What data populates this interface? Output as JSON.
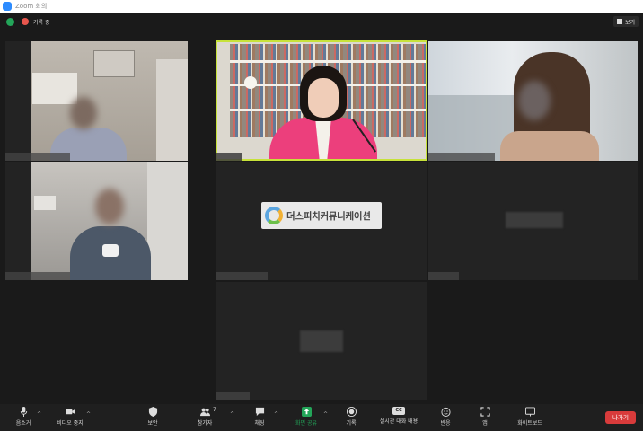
{
  "window": {
    "title": "Zoom 회의"
  },
  "topbar": {
    "recording_label": "기록 중",
    "view_label": "보기"
  },
  "logo": {
    "text": "더스피치커뮤니케이션"
  },
  "toolbar": {
    "mute": "음소거",
    "video": "비디오 중지",
    "security": "보안",
    "participants": "참가자",
    "participants_count": "7",
    "chat": "채팅",
    "share": "화면 공유",
    "record": "기록",
    "captions": "실시간 대화 내용",
    "captions_badge": "CC",
    "reactions": "반응",
    "apps": "앱",
    "whiteboard": "화이트보드",
    "leave": "나가기"
  },
  "colors": {
    "active_speaker": "#c7e23a",
    "leave": "#d83b3b",
    "share": "#23a559"
  }
}
